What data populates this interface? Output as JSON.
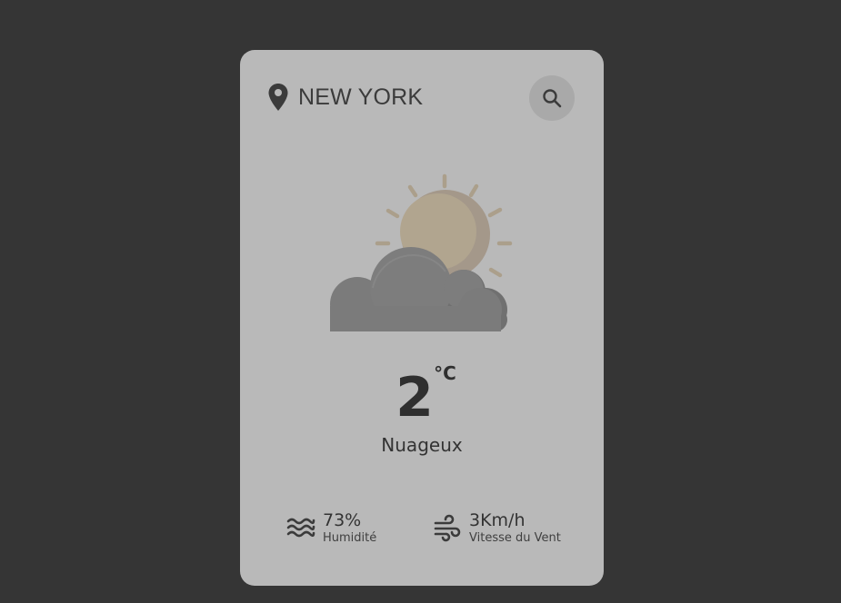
{
  "location": {
    "city": "NEW YORK",
    "icon": "map-pin-icon"
  },
  "search": {
    "icon": "search-icon"
  },
  "weather": {
    "icon": "partly-cloudy-icon",
    "temperature": "2",
    "unit": "°C",
    "description": "Nuageux"
  },
  "stats": {
    "humidity": {
      "value": "73%",
      "label": "Humidité",
      "icon": "humidity-waves-icon"
    },
    "wind": {
      "value": "3Km/h",
      "label": "Vitesse du Vent",
      "icon": "wind-icon"
    }
  },
  "colors": {
    "background": "#353535",
    "card": "#b9b9b9",
    "text": "#333333",
    "sun": "#b0a48f",
    "cloud": "#7a7a7a"
  }
}
